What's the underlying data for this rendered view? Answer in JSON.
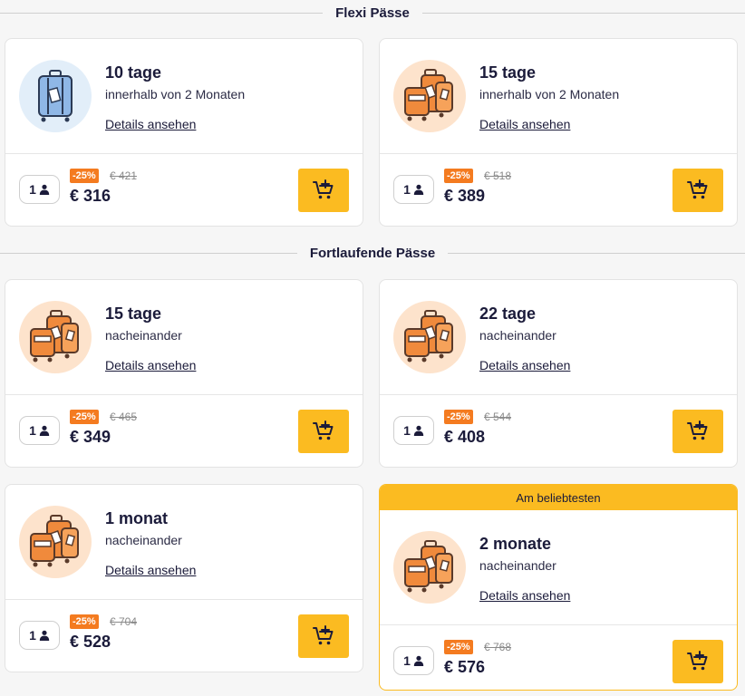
{
  "sections": {
    "flexi": "Flexi Pässe",
    "continuous": "Fortlaufende Pässe"
  },
  "details_label": "Details ansehen",
  "popular_label": "Am beliebtesten",
  "colors": {
    "accent": "#fbbb21",
    "discount": "#f47b20",
    "text": "#1b1b3a"
  },
  "cards": [
    {
      "title": "10 tage",
      "subtitle": "innerhalb von 2 Monaten",
      "pax": "1",
      "discount": "-25%",
      "old_price": "€ 421",
      "price": "€ 316",
      "icon": "suitcase-icon"
    },
    {
      "title": "15 tage",
      "subtitle": "innerhalb von 2 Monaten",
      "pax": "1",
      "discount": "-25%",
      "old_price": "€ 518",
      "price": "€ 389",
      "icon": "luggage-stack-icon"
    },
    {
      "title": "15 tage",
      "subtitle": "nacheinander",
      "pax": "1",
      "discount": "-25%",
      "old_price": "€ 465",
      "price": "€ 349",
      "icon": "luggage-stack-icon"
    },
    {
      "title": "22 tage",
      "subtitle": "nacheinander",
      "pax": "1",
      "discount": "-25%",
      "old_price": "€ 544",
      "price": "€ 408",
      "icon": "luggage-stack-icon"
    },
    {
      "title": "1 monat",
      "subtitle": "nacheinander",
      "pax": "1",
      "discount": "-25%",
      "old_price": "€ 704",
      "price": "€ 528",
      "icon": "luggage-stack-icon"
    },
    {
      "title": "2 monate",
      "subtitle": "nacheinander",
      "pax": "1",
      "discount": "-25%",
      "old_price": "€ 768",
      "price": "€ 576",
      "icon": "luggage-stack-icon"
    }
  ]
}
